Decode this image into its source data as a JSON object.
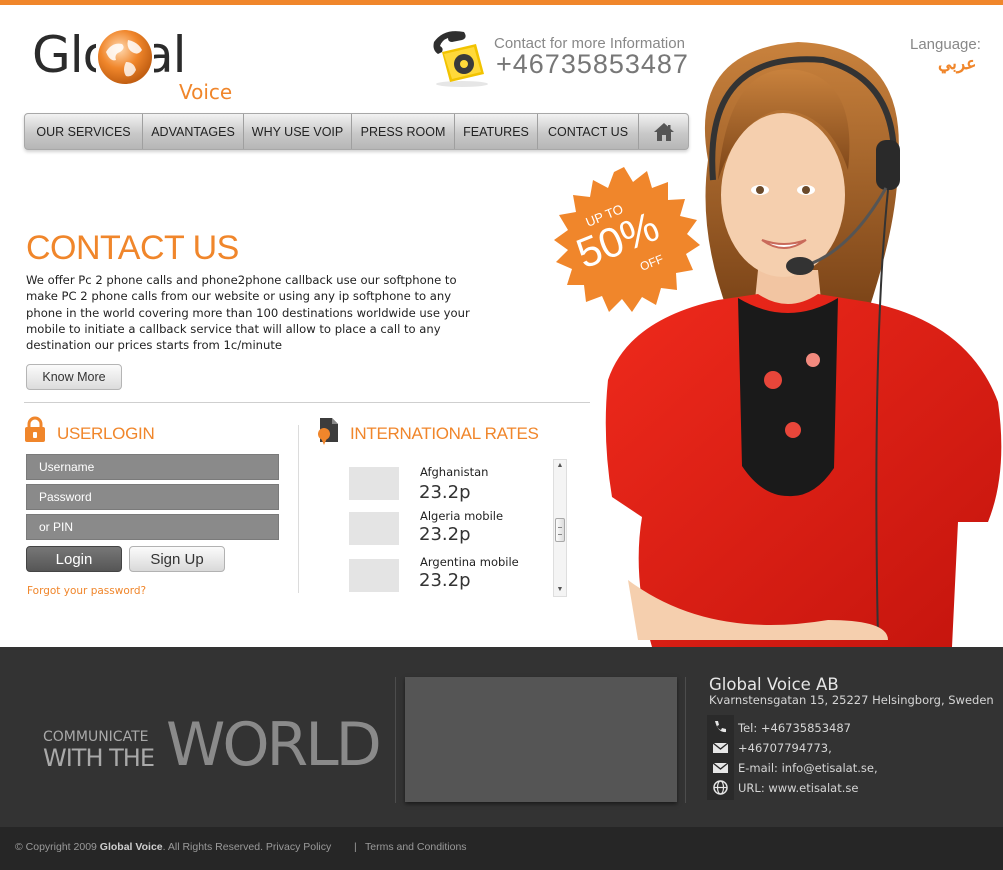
{
  "brand": {
    "logo_main": "Global",
    "logo_sub": "Voice",
    "accent_color": "#f0862b"
  },
  "contact": {
    "label": "Contact for more Information",
    "number": "+46735853487"
  },
  "language": {
    "label": "Language:",
    "value": "عربي"
  },
  "nav": {
    "items": [
      {
        "label": "OUR SERVICES"
      },
      {
        "label": "ADVANTAGES"
      },
      {
        "label": "WHY USE VOIP"
      },
      {
        "label": "PRESS ROOM"
      },
      {
        "label": "FEATURES"
      },
      {
        "label": "CONTACT US"
      }
    ],
    "home_icon": "home-icon"
  },
  "promo": {
    "up_to": "UP TO",
    "value": "50%",
    "off": "OFF"
  },
  "main": {
    "title": "CONTACT US",
    "intro": "We offer Pc 2 phone calls and phone2phone callback use our softphone to make PC 2 phone calls from our website or using any ip softphone to any phone in the world covering more than 100 destinations worldwide use your mobile to initiate a callback service that will allow to place a call to any destination our prices starts from 1c/minute",
    "know_more": "Know More"
  },
  "login": {
    "title": "USERLOGIN",
    "username_placeholder": "Username",
    "password_placeholder": "Password",
    "pin_placeholder": "or PIN",
    "login_button": "Login",
    "signup_button": "Sign Up",
    "forgot": "Forgot your password?"
  },
  "rates": {
    "title": "INTERNATIONAL RATES",
    "items": [
      {
        "name": "Afghanistan",
        "price": "23.2p"
      },
      {
        "name": "Algeria mobile",
        "price": "23.2p"
      },
      {
        "name": "Argentina mobile",
        "price": "23.2p"
      }
    ]
  },
  "footer": {
    "slogan_small": "COMMUNICATE",
    "slogan_mid": "WITH THE",
    "slogan_big": "WORLD",
    "company": "Global Voice AB",
    "address": "Kvarnstensgatan 15, 25227 Helsingborg, Sweden",
    "tel": "Tel: +46735853487",
    "fax": "+46707794773,",
    "email": "E-mail: info@etisalat.se,",
    "url": "URL: www.etisalat.se",
    "copyright_prefix": "© Copyright 2009",
    "copyright_brand": "Global Voice",
    "copyright_suffix": ".  All Rights Reserved. Privacy Policy",
    "separator": "|",
    "terms": "Terms and Conditions"
  }
}
